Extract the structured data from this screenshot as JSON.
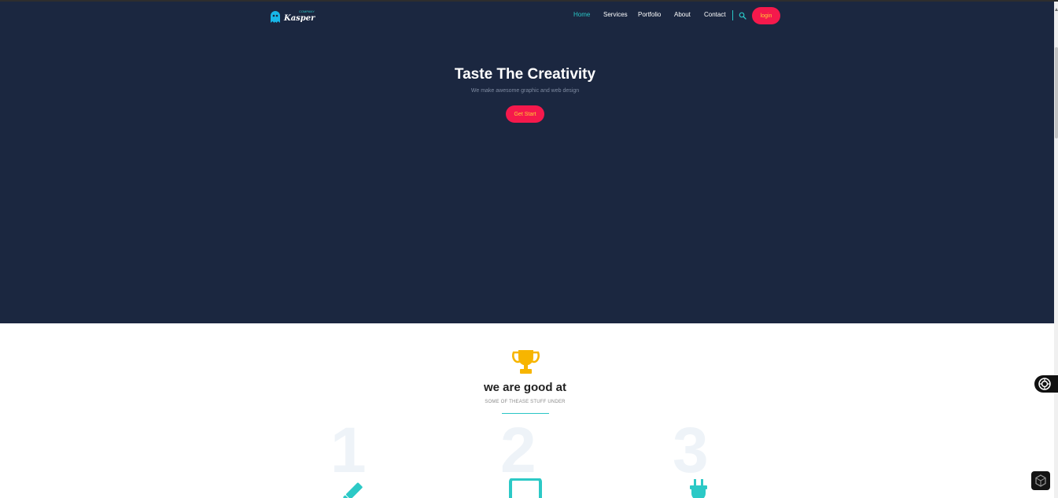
{
  "brand": {
    "name": "Kasper",
    "tagline": "COMPANY"
  },
  "nav": {
    "items": [
      {
        "label": "Home",
        "active": true
      },
      {
        "label": "Services",
        "active": false
      },
      {
        "label": "Portfolio",
        "active": false
      },
      {
        "label": "About",
        "active": false
      },
      {
        "label": "Contact",
        "active": false
      }
    ],
    "search_icon": "search-icon",
    "login_label": "login"
  },
  "hero": {
    "title": "Taste The Creativity",
    "subtitle": "We make awesome graphic and web design",
    "cta_label": "Get Start"
  },
  "features": {
    "icon": "trophy-icon",
    "title": "we are good at",
    "subtitle": "SOME OF THEASE STUFF UNDER",
    "items": [
      {
        "number": "1",
        "icon": "pencil-icon"
      },
      {
        "number": "2",
        "icon": "laptop-icon"
      },
      {
        "number": "3",
        "icon": "plug-icon"
      }
    ]
  },
  "colors": {
    "hero_bg": "#1b2740",
    "accent": "#29c6c6",
    "cta": "#f5194c",
    "cta_text": "#ffcc33",
    "trophy": "#f7b500"
  }
}
